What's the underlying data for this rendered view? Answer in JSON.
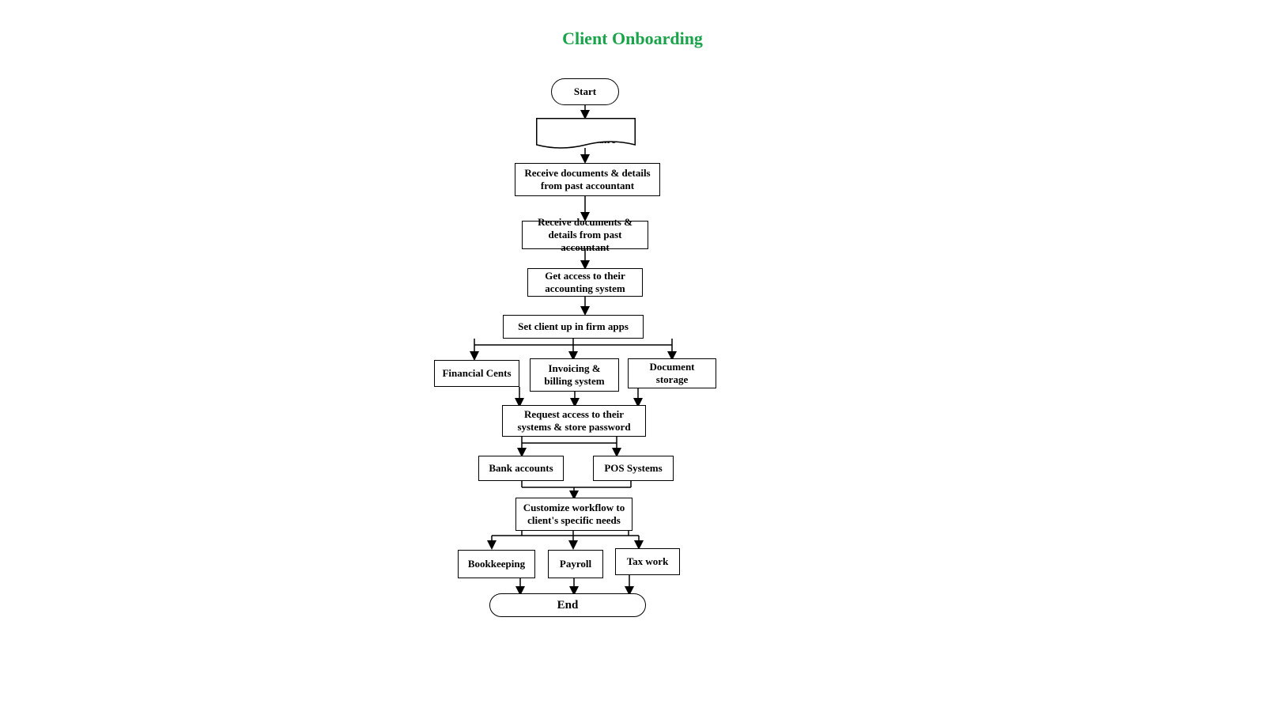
{
  "title": "Client Onboarding",
  "nodes": {
    "start": "Start",
    "send_q": "Send new client questionnaire",
    "recv1": "Receive documents & details from past accountant",
    "recv2": "Receive documents & details from past accountant",
    "get_access": "Get access to their accounting system",
    "set_firm_apps": "Set client up in firm apps",
    "fin_cents": "Financial Cents",
    "invoicing": "Invoicing & billing system",
    "doc_storage": "Document storage",
    "req_access": "Request access to their systems & store password",
    "bank": "Bank accounts",
    "pos": "POS Systems",
    "customize": "Customize workflow to client's specific needs",
    "bookkeeping": "Bookkeeping",
    "payroll": "Payroll",
    "tax": "Tax work",
    "end": "End"
  }
}
